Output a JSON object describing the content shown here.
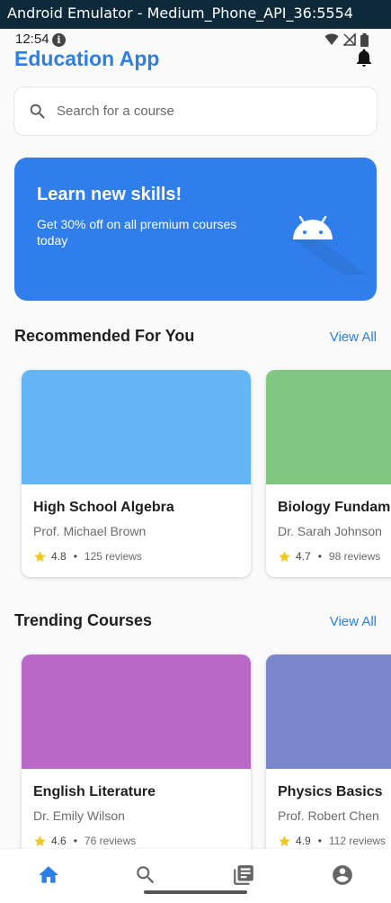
{
  "window": {
    "title": "Android Emulator - Medium_Phone_API_36:5554"
  },
  "status_bar": {
    "time": "12:54",
    "info_glyph": "i",
    "icons": [
      "info-icon",
      "wifi-icon",
      "signal-icon",
      "battery-icon"
    ]
  },
  "header": {
    "title": "Education App",
    "bell_icon": "bell-icon"
  },
  "search": {
    "placeholder": "Search for a course",
    "icon": "search-icon"
  },
  "banner": {
    "title": "Learn new skills!",
    "subtitle": "Get 30% off on all premium courses today",
    "icon": "android-icon",
    "color": "#2f7eeb"
  },
  "recommended": {
    "title": "Recommended For You",
    "view_all": "View All",
    "courses": [
      {
        "title": "High School Algebra",
        "author": "Prof. Michael Brown",
        "rating": "4.8",
        "reviews": "125 reviews",
        "color": "#64b5f6"
      },
      {
        "title": "Biology Fundame",
        "author": "Dr. Sarah Johnson",
        "rating": "4.7",
        "reviews": "98 reviews",
        "color": "#81c784"
      }
    ]
  },
  "trending": {
    "title": "Trending Courses",
    "view_all": "View All",
    "courses": [
      {
        "title": "English Literature",
        "author": "Dr. Emily Wilson",
        "rating": "4.6",
        "reviews": "76 reviews",
        "color": "#ba68c8"
      },
      {
        "title": "Physics Basics",
        "author": "Prof. Robert Chen",
        "rating": "4.9",
        "reviews": "112 reviews",
        "color": "#7986cb"
      }
    ]
  },
  "separator": "•",
  "bottom_nav": {
    "items": [
      {
        "icon": "home-icon",
        "active": true
      },
      {
        "icon": "search-icon",
        "active": false
      },
      {
        "icon": "library-books-icon",
        "active": false
      },
      {
        "icon": "account-icon",
        "active": false
      }
    ]
  },
  "colors": {
    "accent": "#2b7fe6",
    "star": "#f5c518",
    "inactive_icon": "#666666"
  }
}
